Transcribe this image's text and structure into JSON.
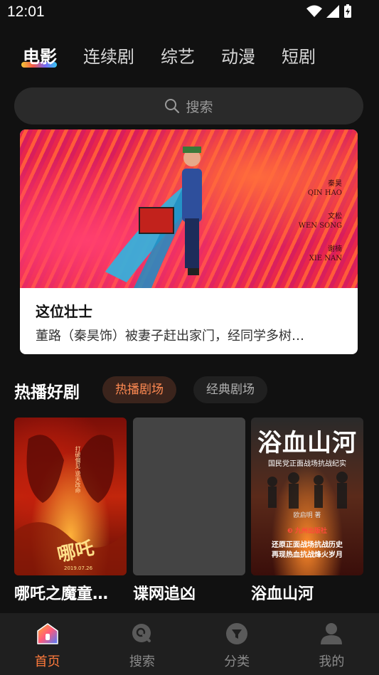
{
  "status_bar": {
    "time": "12:01"
  },
  "tabs": [
    {
      "label": "电影",
      "active": true
    },
    {
      "label": "连续剧",
      "active": false
    },
    {
      "label": "综艺",
      "active": false
    },
    {
      "label": "动漫",
      "active": false
    },
    {
      "label": "短剧",
      "active": false
    }
  ],
  "search": {
    "placeholder": "搜索"
  },
  "banner": {
    "title": "这位壮士",
    "description": "董路（秦昊饰）被妻子赶出家门，经同学多树…",
    "credits": {
      "role1": "秦昊",
      "name1": "QIN HAO",
      "role2": "文松",
      "name2": "WEN SONG",
      "role3": "谢楠",
      "name3": "XIE NAN"
    }
  },
  "section": {
    "title": "热播好剧",
    "chips": [
      {
        "label": "热播剧场",
        "active": true
      },
      {
        "label": "经典剧场",
        "active": false
      }
    ]
  },
  "cards": [
    {
      "name": "哪吒之魔童…",
      "poster": {
        "logo": "哪吒",
        "side_text": "打破偏见 逆天改命",
        "date": "2019.07.26"
      }
    },
    {
      "name": "谍网追凶"
    },
    {
      "name": "浴血山河",
      "poster": {
        "title": "浴血山河",
        "subtitle": "国民党正面战场抗战纪实",
        "author": "欧启明 著",
        "publisher": "❸ 九州出版社",
        "blurb1": "还原正面战场抗战历史",
        "blurb2": "再现热血抗战烽火岁月"
      }
    }
  ],
  "bottom_nav": [
    {
      "label": "首页",
      "icon": "home-icon",
      "active": true
    },
    {
      "label": "搜索",
      "icon": "search-icon",
      "active": false
    },
    {
      "label": "分类",
      "icon": "category-icon",
      "active": false
    },
    {
      "label": "我的",
      "icon": "profile-icon",
      "active": false
    }
  ],
  "colors": {
    "accent": "#ff7a3c",
    "background": "#111111"
  }
}
